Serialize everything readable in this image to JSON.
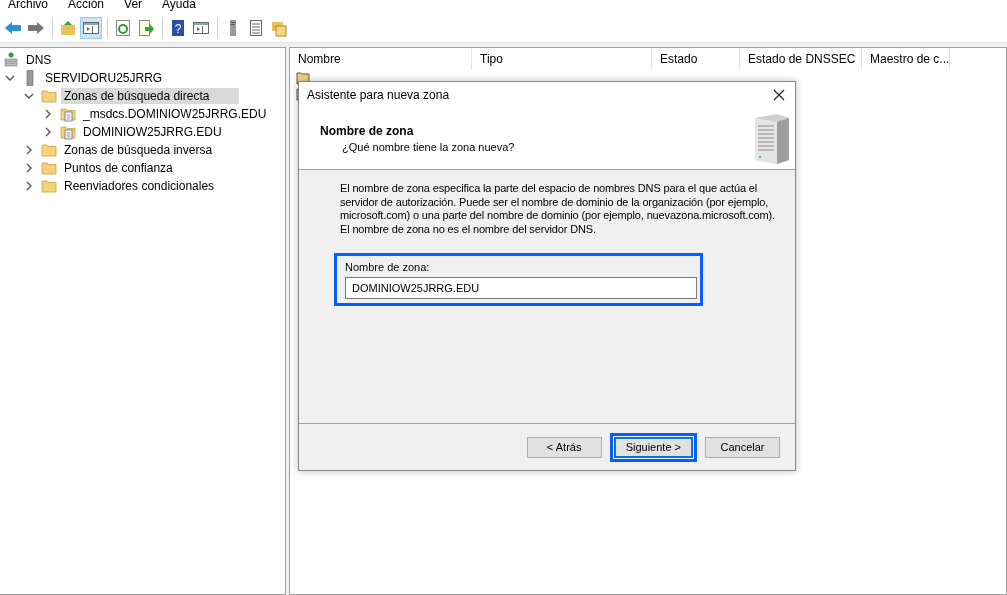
{
  "menu": [
    "Archivo",
    "Acción",
    "Ver",
    "Ayuda"
  ],
  "toolbar": [
    {
      "kind": "back",
      "selected": false
    },
    {
      "kind": "forward",
      "selected": false
    },
    {
      "kind": "sep"
    },
    {
      "kind": "up",
      "selected": false
    },
    {
      "kind": "tree",
      "selected": true
    },
    {
      "kind": "sep"
    },
    {
      "kind": "refresh",
      "selected": false
    },
    {
      "kind": "export",
      "selected": false
    },
    {
      "kind": "sep"
    },
    {
      "kind": "help",
      "selected": false,
      "glyph": "?"
    },
    {
      "kind": "pane",
      "selected": false
    },
    {
      "kind": "sep"
    },
    {
      "kind": "server",
      "selected": false
    },
    {
      "kind": "list",
      "selected": false
    },
    {
      "kind": "folders",
      "selected": false
    }
  ],
  "tree": [
    {
      "label": "DNS",
      "kind": "dns",
      "selected": false,
      "children": [
        {
          "label": "SERVIDORU25JRRG",
          "kind": "server",
          "selected": false,
          "expanded": true,
          "children": [
            {
              "label": "Zonas de búsqueda directa",
              "kind": "folder",
              "selected": true,
              "expanded": true,
              "children": [
                {
                  "label": "_msdcs.DOMINIOW25JRRG.EDU",
                  "kind": "zone",
                  "selected": false,
                  "expanded": false
                },
                {
                  "label": "DOMINIOW25JRRG.EDU",
                  "kind": "zone",
                  "selected": false,
                  "expanded": false
                }
              ]
            },
            {
              "label": "Zonas de búsqueda inversa",
              "kind": "folder",
              "selected": false,
              "expanded": false
            },
            {
              "label": "Puntos de confianza",
              "kind": "folder",
              "selected": false,
              "expanded": false
            },
            {
              "label": "Reenviadores condicionales",
              "kind": "folder",
              "selected": false,
              "expanded": false
            }
          ]
        }
      ]
    }
  ],
  "list": {
    "columns": [
      "Nombre",
      "Tipo",
      "Estado",
      "Estado de DNSSEC",
      "Maestro de c..."
    ],
    "rows": [
      {
        "kind": "zone"
      },
      {
        "kind": "zone"
      }
    ]
  },
  "dialog": {
    "title": "Asistente para nueva zona",
    "heading": "Nombre de zona",
    "subheading": "¿Qué nombre tiene la zona  nueva?",
    "description": "El nombre de zona especifica la parte del espacio de nombres DNS para el que actúa el servidor de autorización. Puede ser el nombre de dominio de la organización (por ejemplo, microsoft.com) o una parte del nombre de dominio (por ejemplo, nuevazona.microsoft.com). El nombre de zona no es el nombre del servidor DNS.",
    "field": {
      "label": "Nombre de zona:",
      "value": "DOMINIOW25JRRG.EDU",
      "highlighted": true
    },
    "buttons": [
      {
        "label": "< Atrás",
        "highlighted": false
      },
      {
        "label": "Siguiente >",
        "highlighted": true
      },
      {
        "label": "Cancelar",
        "highlighted": false
      }
    ]
  }
}
